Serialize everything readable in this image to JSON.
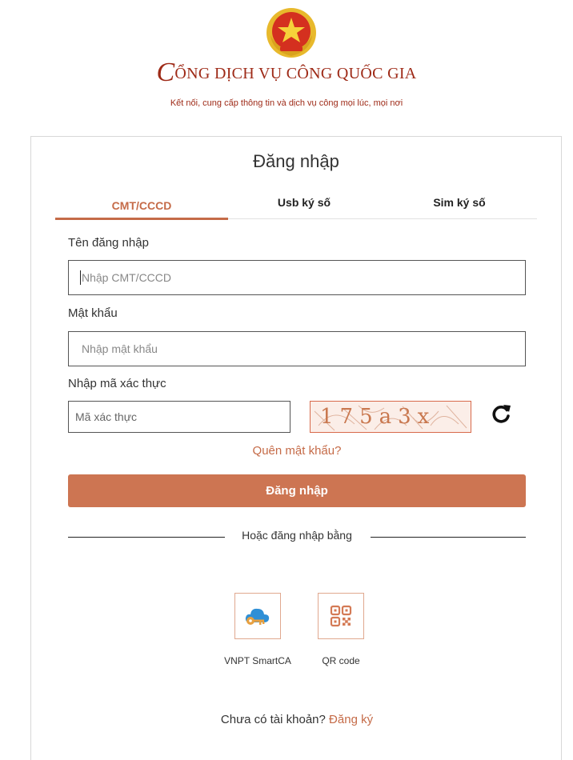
{
  "header": {
    "brand_initial": "C",
    "brand_rest": "ỔNG DỊCH VỤ CÔNG QUỐC GIA",
    "tagline": "Kết nối, cung cấp thông tin và dịch vụ công mọi lúc, mọi nơi"
  },
  "login": {
    "title": "Đăng nhập",
    "tabs": [
      {
        "label": "CMT/CCCD",
        "active": true
      },
      {
        "label": "Usb ký số",
        "active": false
      },
      {
        "label": "Sim ký số",
        "active": false
      }
    ],
    "username": {
      "label": "Tên đăng nhập",
      "placeholder": "Nhập CMT/CCCD",
      "value": ""
    },
    "password": {
      "label": "Mật khẩu",
      "placeholder": "Nhập mật khẩu",
      "value": ""
    },
    "captcha": {
      "label": "Nhập mã xác thực",
      "placeholder": "Mã xác thực",
      "value": "",
      "image_text": "175a3x"
    },
    "forgot_password": "Quên mật khẩu?",
    "submit_label": "Đăng nhập",
    "divider_text": "Hoặc đăng nhập bằng",
    "alt_options": [
      {
        "label": "VNPT SmartCA",
        "icon": "cloud-key-icon"
      },
      {
        "label": "QR code",
        "icon": "qr-code-icon"
      }
    ],
    "signup_prompt": "Chưa có tài khoản?",
    "signup_link": "Đăng ký"
  },
  "colors": {
    "accent": "#cd7552",
    "brand_red": "#9e2a17",
    "link": "#c56b48"
  }
}
